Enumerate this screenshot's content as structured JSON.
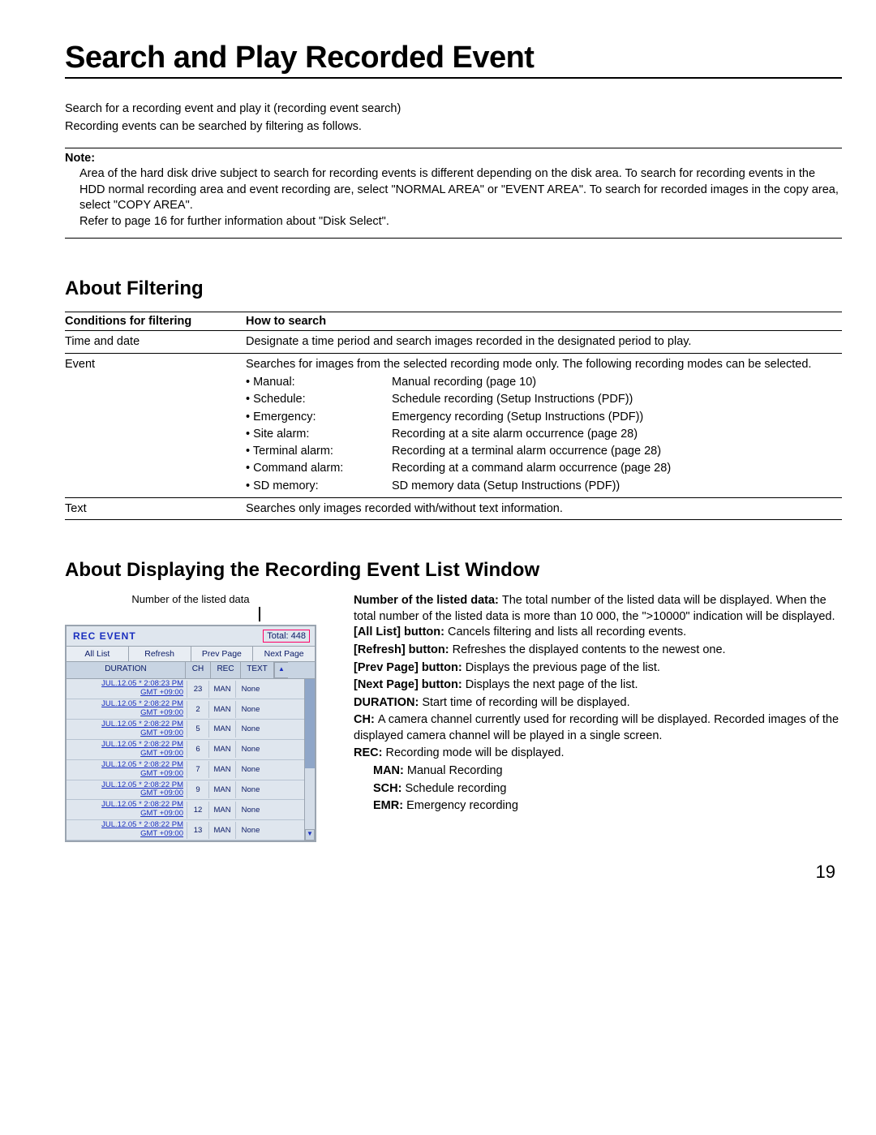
{
  "title": "Search and Play Recorded Event",
  "intro": {
    "l1": "Search for a recording event and play it (recording event search)",
    "l2": "Recording events can be searched by filtering as follows."
  },
  "note": {
    "label": "Note:",
    "p1": "Area of the hard disk drive subject to search for recording events is different depending on the disk area. To search for recording events in the HDD normal recording area and event recording are, select \"NORMAL AREA\" or \"EVENT AREA\". To search for recorded images in the copy area, select \"COPY AREA\".",
    "p2": "Refer to page 16 for further information about \"Disk Select\"."
  },
  "section_filtering": "About Filtering",
  "filter_table": {
    "th1": "Conditions for filtering",
    "th2": "How to search",
    "row1": {
      "k": "Time and date",
      "v": "Designate a time period and search images recorded in the designated period to play."
    },
    "row2": {
      "k": "Event",
      "intro": "Searches for images from the selected recording mode only. The following recording modes can be selected.",
      "bullets": {
        "labels": {
          "b1": "• Manual:",
          "b2": "• Schedule:",
          "b3": "• Emergency:",
          "b4": "• Site alarm:",
          "b5": "• Terminal alarm:",
          "b6": "• Command alarm:",
          "b7": "• SD memory:"
        },
        "descs": {
          "d1": "Manual recording (page 10)",
          "d2": "Schedule recording (Setup Instructions (PDF))",
          "d3": "Emergency recording (Setup Instructions (PDF))",
          "d4": "Recording at a site alarm occurrence (page 28)",
          "d5": "Recording at a terminal alarm occurrence (page 28)",
          "d6": "Recording at a command alarm occurrence (page 28)",
          "d7": "SD memory data (Setup Instructions (PDF))"
        }
      }
    },
    "row3": {
      "k": "Text",
      "v": "Searches only images recorded with/without text information."
    }
  },
  "section_window": "About Displaying the Recording Event List Window",
  "caption": "Number of the listed data",
  "window": {
    "title": "REC EVENT",
    "total": "Total: 448",
    "btns": {
      "b1": "All List",
      "b2": "Refresh",
      "b3": "Prev Page",
      "b4": "Next Page"
    },
    "head": {
      "h1": "DURATION",
      "h2": "CH",
      "h3": "REC",
      "h4": "TEXT"
    },
    "rows": [
      {
        "l1": "JUL.12.05  * 2:08:23 PM",
        "l2": "GMT +09:00",
        "ch": "23",
        "rec": "MAN",
        "text": "None"
      },
      {
        "l1": "JUL.12.05  * 2:08:22 PM",
        "l2": "GMT +09:00",
        "ch": "2",
        "rec": "MAN",
        "text": "None"
      },
      {
        "l1": "JUL.12.05  * 2:08:22 PM",
        "l2": "GMT +09:00",
        "ch": "5",
        "rec": "MAN",
        "text": "None"
      },
      {
        "l1": "JUL.12.05  * 2:08:22 PM",
        "l2": "GMT +09:00",
        "ch": "6",
        "rec": "MAN",
        "text": "None"
      },
      {
        "l1": "JUL.12.05  * 2:08:22 PM",
        "l2": "GMT +09:00",
        "ch": "7",
        "rec": "MAN",
        "text": "None"
      },
      {
        "l1": "JUL.12.05  * 2:08:22 PM",
        "l2": "GMT +09:00",
        "ch": "9",
        "rec": "MAN",
        "text": "None"
      },
      {
        "l1": "JUL.12.05  * 2:08:22 PM",
        "l2": "GMT +09:00",
        "ch": "12",
        "rec": "MAN",
        "text": "None"
      },
      {
        "l1": "JUL.12.05  * 2:08:22 PM",
        "l2": "GMT +09:00",
        "ch": "13",
        "rec": "MAN",
        "text": "None"
      }
    ]
  },
  "descs": {
    "d1a": "Number of the listed data: ",
    "d1b": "The total number of the listed data will be displayed. When the total number of the listed data is more than 10 000, the \">10000\" indication will be displayed.",
    "d2a": "[All List] button: ",
    "d2b": "Cancels filtering and lists all recording events.",
    "d3a": "[Refresh] button: ",
    "d3b": "Refreshes the displayed contents to the newest one.",
    "d4a": "[Prev Page] button: ",
    "d4b": "Displays the previous page of the list.",
    "d5a": "[Next Page] button: ",
    "d5b": "Displays the next page of the list.",
    "d6a": "DURATION: ",
    "d6b": "Start time of recording will be displayed.",
    "d7a": "CH: ",
    "d7b": "A camera channel currently used for recording will be displayed. Recorded images of the displayed camera channel will be played in a single screen.",
    "d8a": "REC: ",
    "d8b": "Recording mode will be displayed.",
    "d9a": "MAN: ",
    "d9b": "Manual Recording",
    "d10a": "SCH: ",
    "d10b": "Schedule recording",
    "d11a": "EMR: ",
    "d11b": "Emergency recording"
  },
  "page_num": "19"
}
